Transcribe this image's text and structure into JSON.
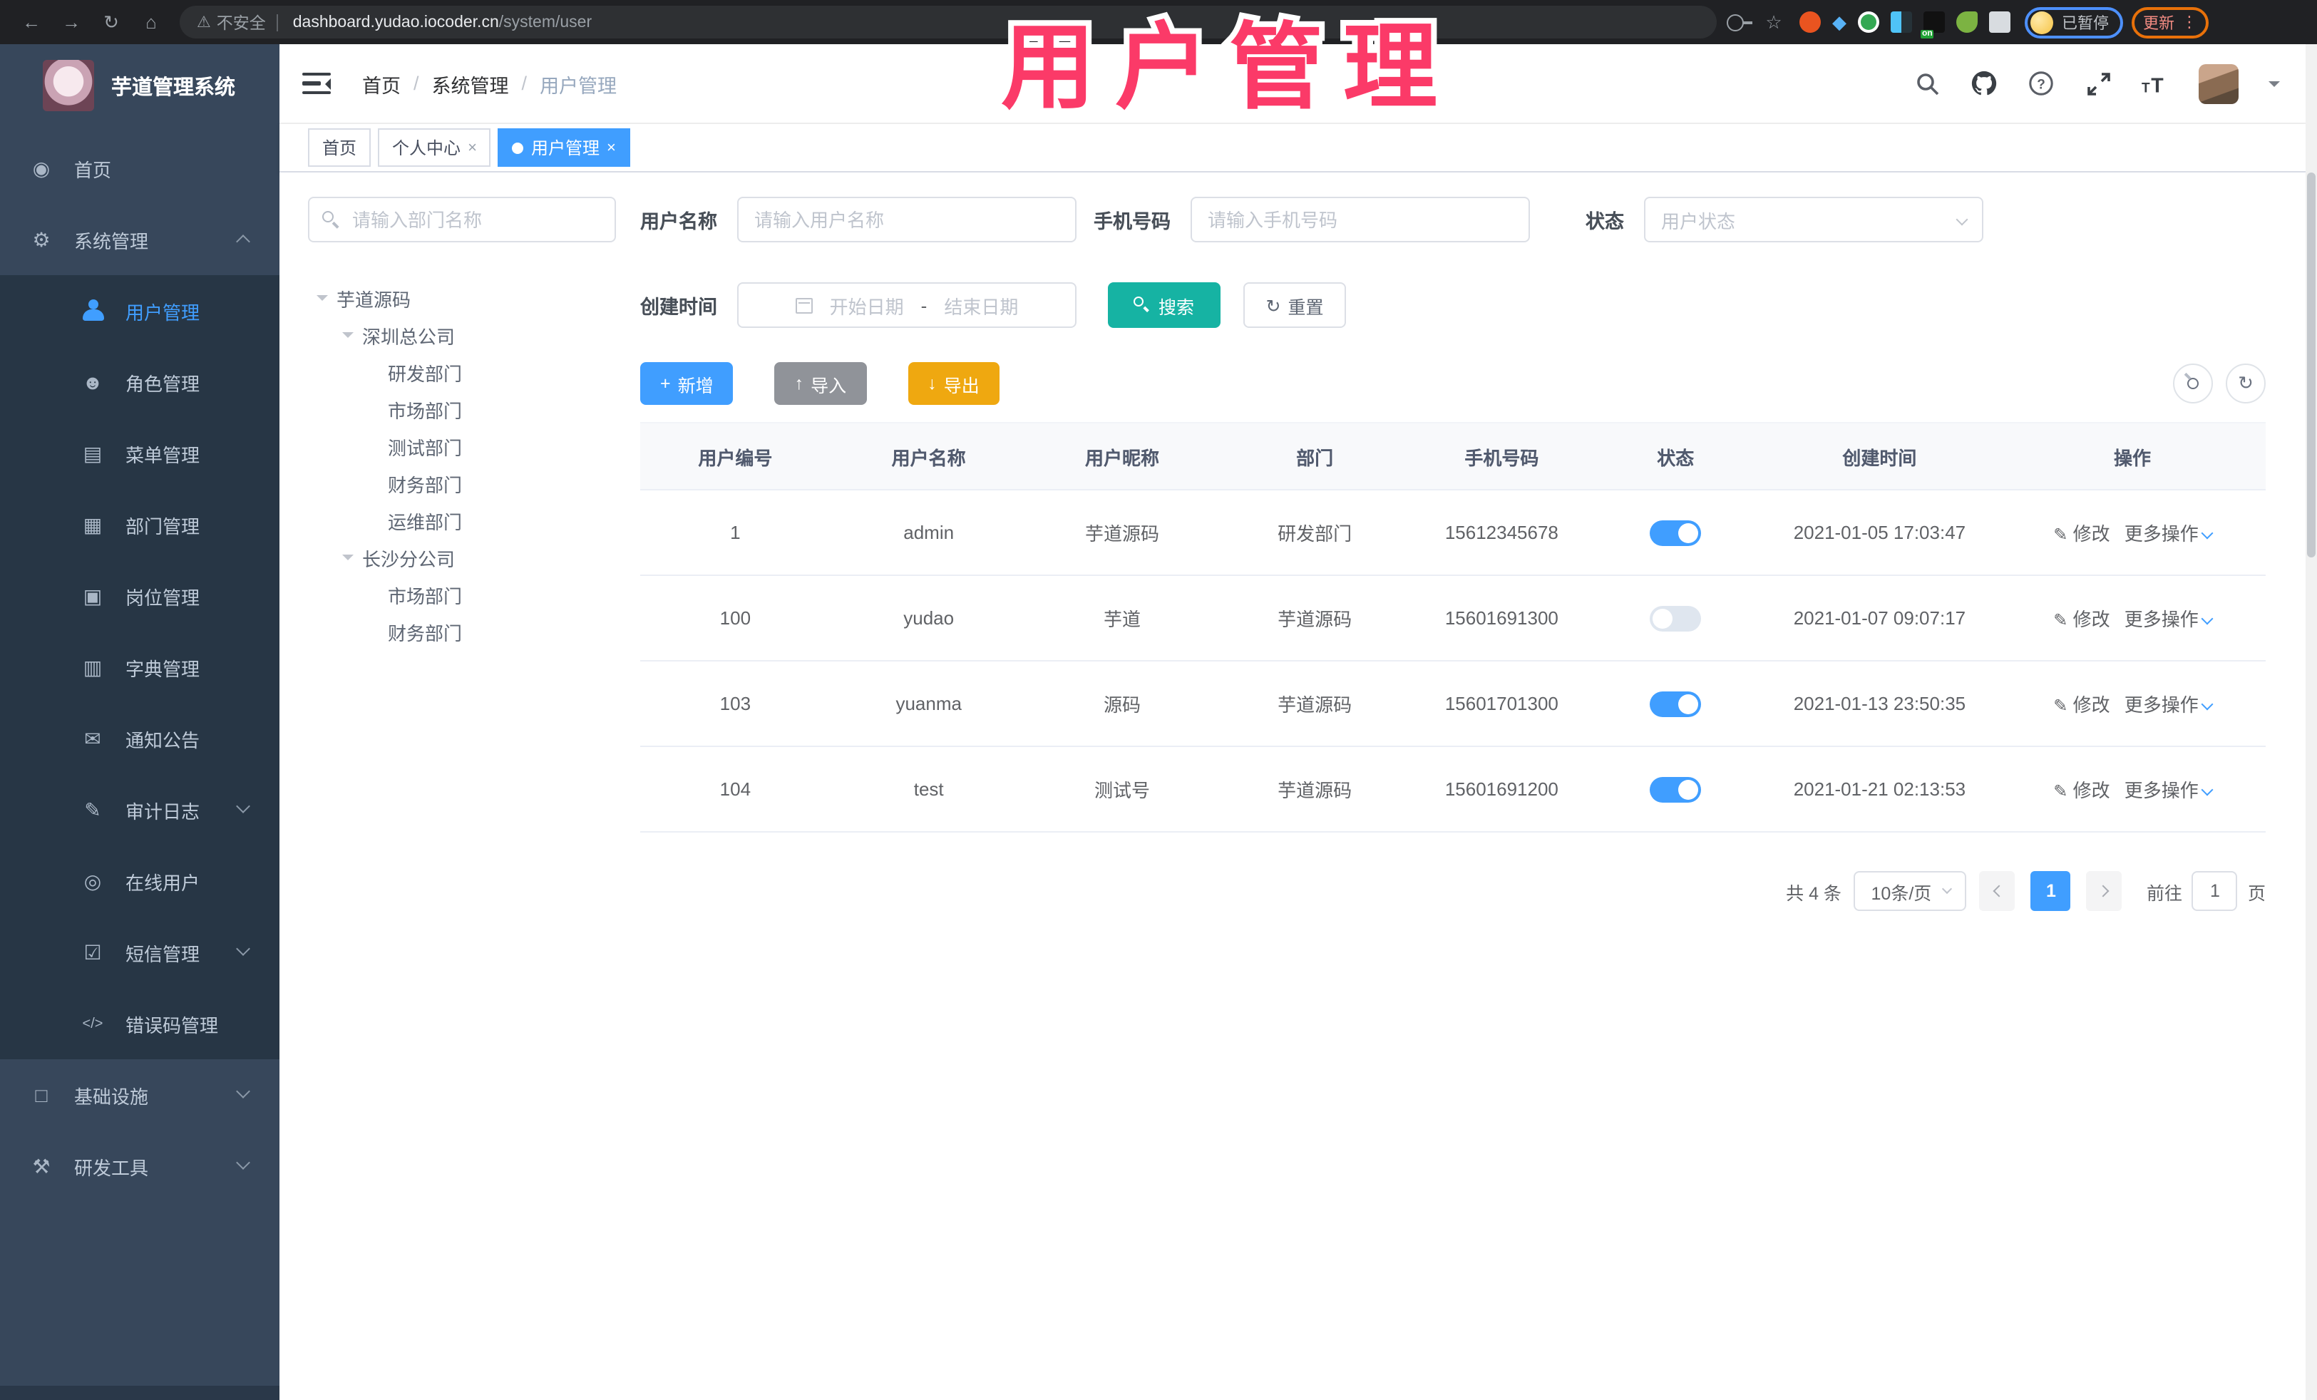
{
  "browser": {
    "security_label": "不安全",
    "url_host": "dashboard.yudao.iocoder.cn",
    "url_path": "/system/user",
    "extension_on_badge": "on",
    "profile_status": "已暂停",
    "update_label": "更新"
  },
  "overlay": {
    "title": "用户管理",
    "color": "#fb3a68"
  },
  "icons": {
    "back": "←",
    "forward": "→",
    "reload": "↻",
    "home": "⌂",
    "warning": "⚠",
    "star": "☆",
    "dots": "⋮",
    "gem": "◆",
    "dashboard": "◉",
    "gear": "⚙",
    "roles": "☻",
    "menu": "▤",
    "dept": "▦",
    "post": "▣",
    "dict": "▥",
    "notice": "✉",
    "log": "✎",
    "online": "◎",
    "sms": "☑",
    "code": "</>",
    "infra": "□",
    "tools": "⚒",
    "plus": "+",
    "upload": "↑",
    "download": "↓",
    "refresh": "↻",
    "edit": "✎",
    "close": "×",
    "help": "?"
  },
  "sidebar": {
    "logo_title": "芋道管理系统",
    "items": [
      {
        "label": "首页"
      },
      {
        "label": "系统管理"
      },
      {
        "label": "用户管理"
      },
      {
        "label": "角色管理"
      },
      {
        "label": "菜单管理"
      },
      {
        "label": "部门管理"
      },
      {
        "label": "岗位管理"
      },
      {
        "label": "字典管理"
      },
      {
        "label": "通知公告"
      },
      {
        "label": "审计日志"
      },
      {
        "label": "在线用户"
      },
      {
        "label": "短信管理"
      },
      {
        "label": "错误码管理"
      },
      {
        "label": "基础设施"
      },
      {
        "label": "研发工具"
      }
    ]
  },
  "header": {
    "breadcrumb": [
      "首页",
      "系统管理",
      "用户管理"
    ],
    "separator": "/"
  },
  "tabs": [
    {
      "label": "首页"
    },
    {
      "label": "个人中心"
    },
    {
      "label": "用户管理"
    }
  ],
  "dept_panel": {
    "search_placeholder": "请输入部门名称",
    "tree": [
      {
        "label": "芋道源码"
      },
      {
        "label": "深圳总公司"
      },
      {
        "label": "研发部门"
      },
      {
        "label": "市场部门"
      },
      {
        "label": "测试部门"
      },
      {
        "label": "财务部门"
      },
      {
        "label": "运维部门"
      },
      {
        "label": "长沙分公司"
      },
      {
        "label": "市场部门"
      },
      {
        "label": "财务部门"
      }
    ]
  },
  "filters": {
    "user_name_label": "用户名称",
    "user_name_placeholder": "请输入用户名称",
    "mobile_label": "手机号码",
    "mobile_placeholder": "请输入手机号码",
    "status_label": "状态",
    "status_placeholder": "用户状态",
    "create_time_label": "创建时间",
    "start_placeholder": "开始日期",
    "range_separator": "-",
    "end_placeholder": "结束日期",
    "search_label": "搜索",
    "reset_label": "重置"
  },
  "toolbar": {
    "add_label": "新增",
    "import_label": "导入",
    "export_label": "导出"
  },
  "table": {
    "headers": [
      "用户编号",
      "用户名称",
      "用户昵称",
      "部门",
      "手机号码",
      "状态",
      "创建时间",
      "操作"
    ],
    "actions": {
      "edit": "修改",
      "more": "更多操作"
    },
    "rows": [
      {
        "id": "1",
        "username": "admin",
        "nickname": "芋道源码",
        "dept": "研发部门",
        "mobile": "15612345678",
        "status": "on",
        "created": "2021-01-05 17:03:47"
      },
      {
        "id": "100",
        "username": "yudao",
        "nickname": "芋道",
        "dept": "芋道源码",
        "mobile": "15601691300",
        "status": "off",
        "created": "2021-01-07 09:07:17"
      },
      {
        "id": "103",
        "username": "yuanma",
        "nickname": "源码",
        "dept": "芋道源码",
        "mobile": "15601701300",
        "status": "on",
        "created": "2021-01-13 23:50:35"
      },
      {
        "id": "104",
        "username": "test",
        "nickname": "测试号",
        "dept": "芋道源码",
        "mobile": "15601691200",
        "status": "on",
        "created": "2021-01-21 02:13:53"
      }
    ]
  },
  "pagination": {
    "total_text": "共 4 条",
    "page_size": "10条/页",
    "current_page": "1",
    "jump_prefix": "前往",
    "jump_value": "1",
    "jump_suffix": "页"
  }
}
